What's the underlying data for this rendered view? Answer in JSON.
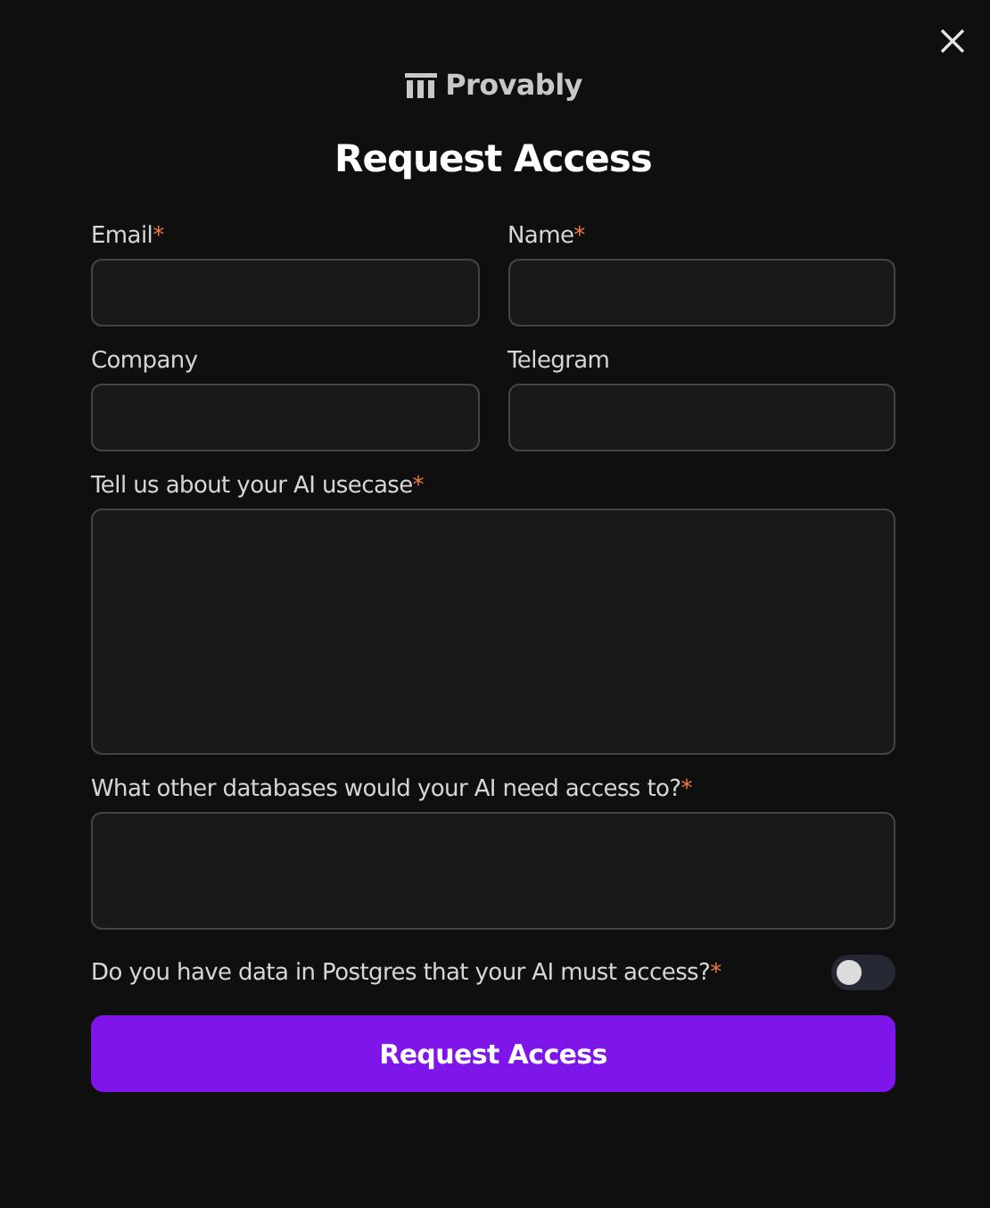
{
  "brand": "Provably",
  "title": "Request Access",
  "fields": [
    {
      "label": "Email",
      "required_mark": "*",
      "kind": "input"
    },
    {
      "label": "Name",
      "required_mark": "*",
      "kind": "input"
    },
    {
      "label": "Company",
      "kind": "input"
    },
    {
      "label": "Telegram",
      "kind": "input"
    },
    {
      "label": "Tell us about your AI usecase",
      "required_mark": "*",
      "kind": "textarea"
    },
    {
      "label": "What other databases would your AI need access to?",
      "required_mark": "*",
      "kind": "textarea-small"
    }
  ],
  "toggle": {
    "label": "Do you have data in Postgres that your AI must access?",
    "required_mark": "*",
    "on": false
  },
  "submit": "Request Access"
}
